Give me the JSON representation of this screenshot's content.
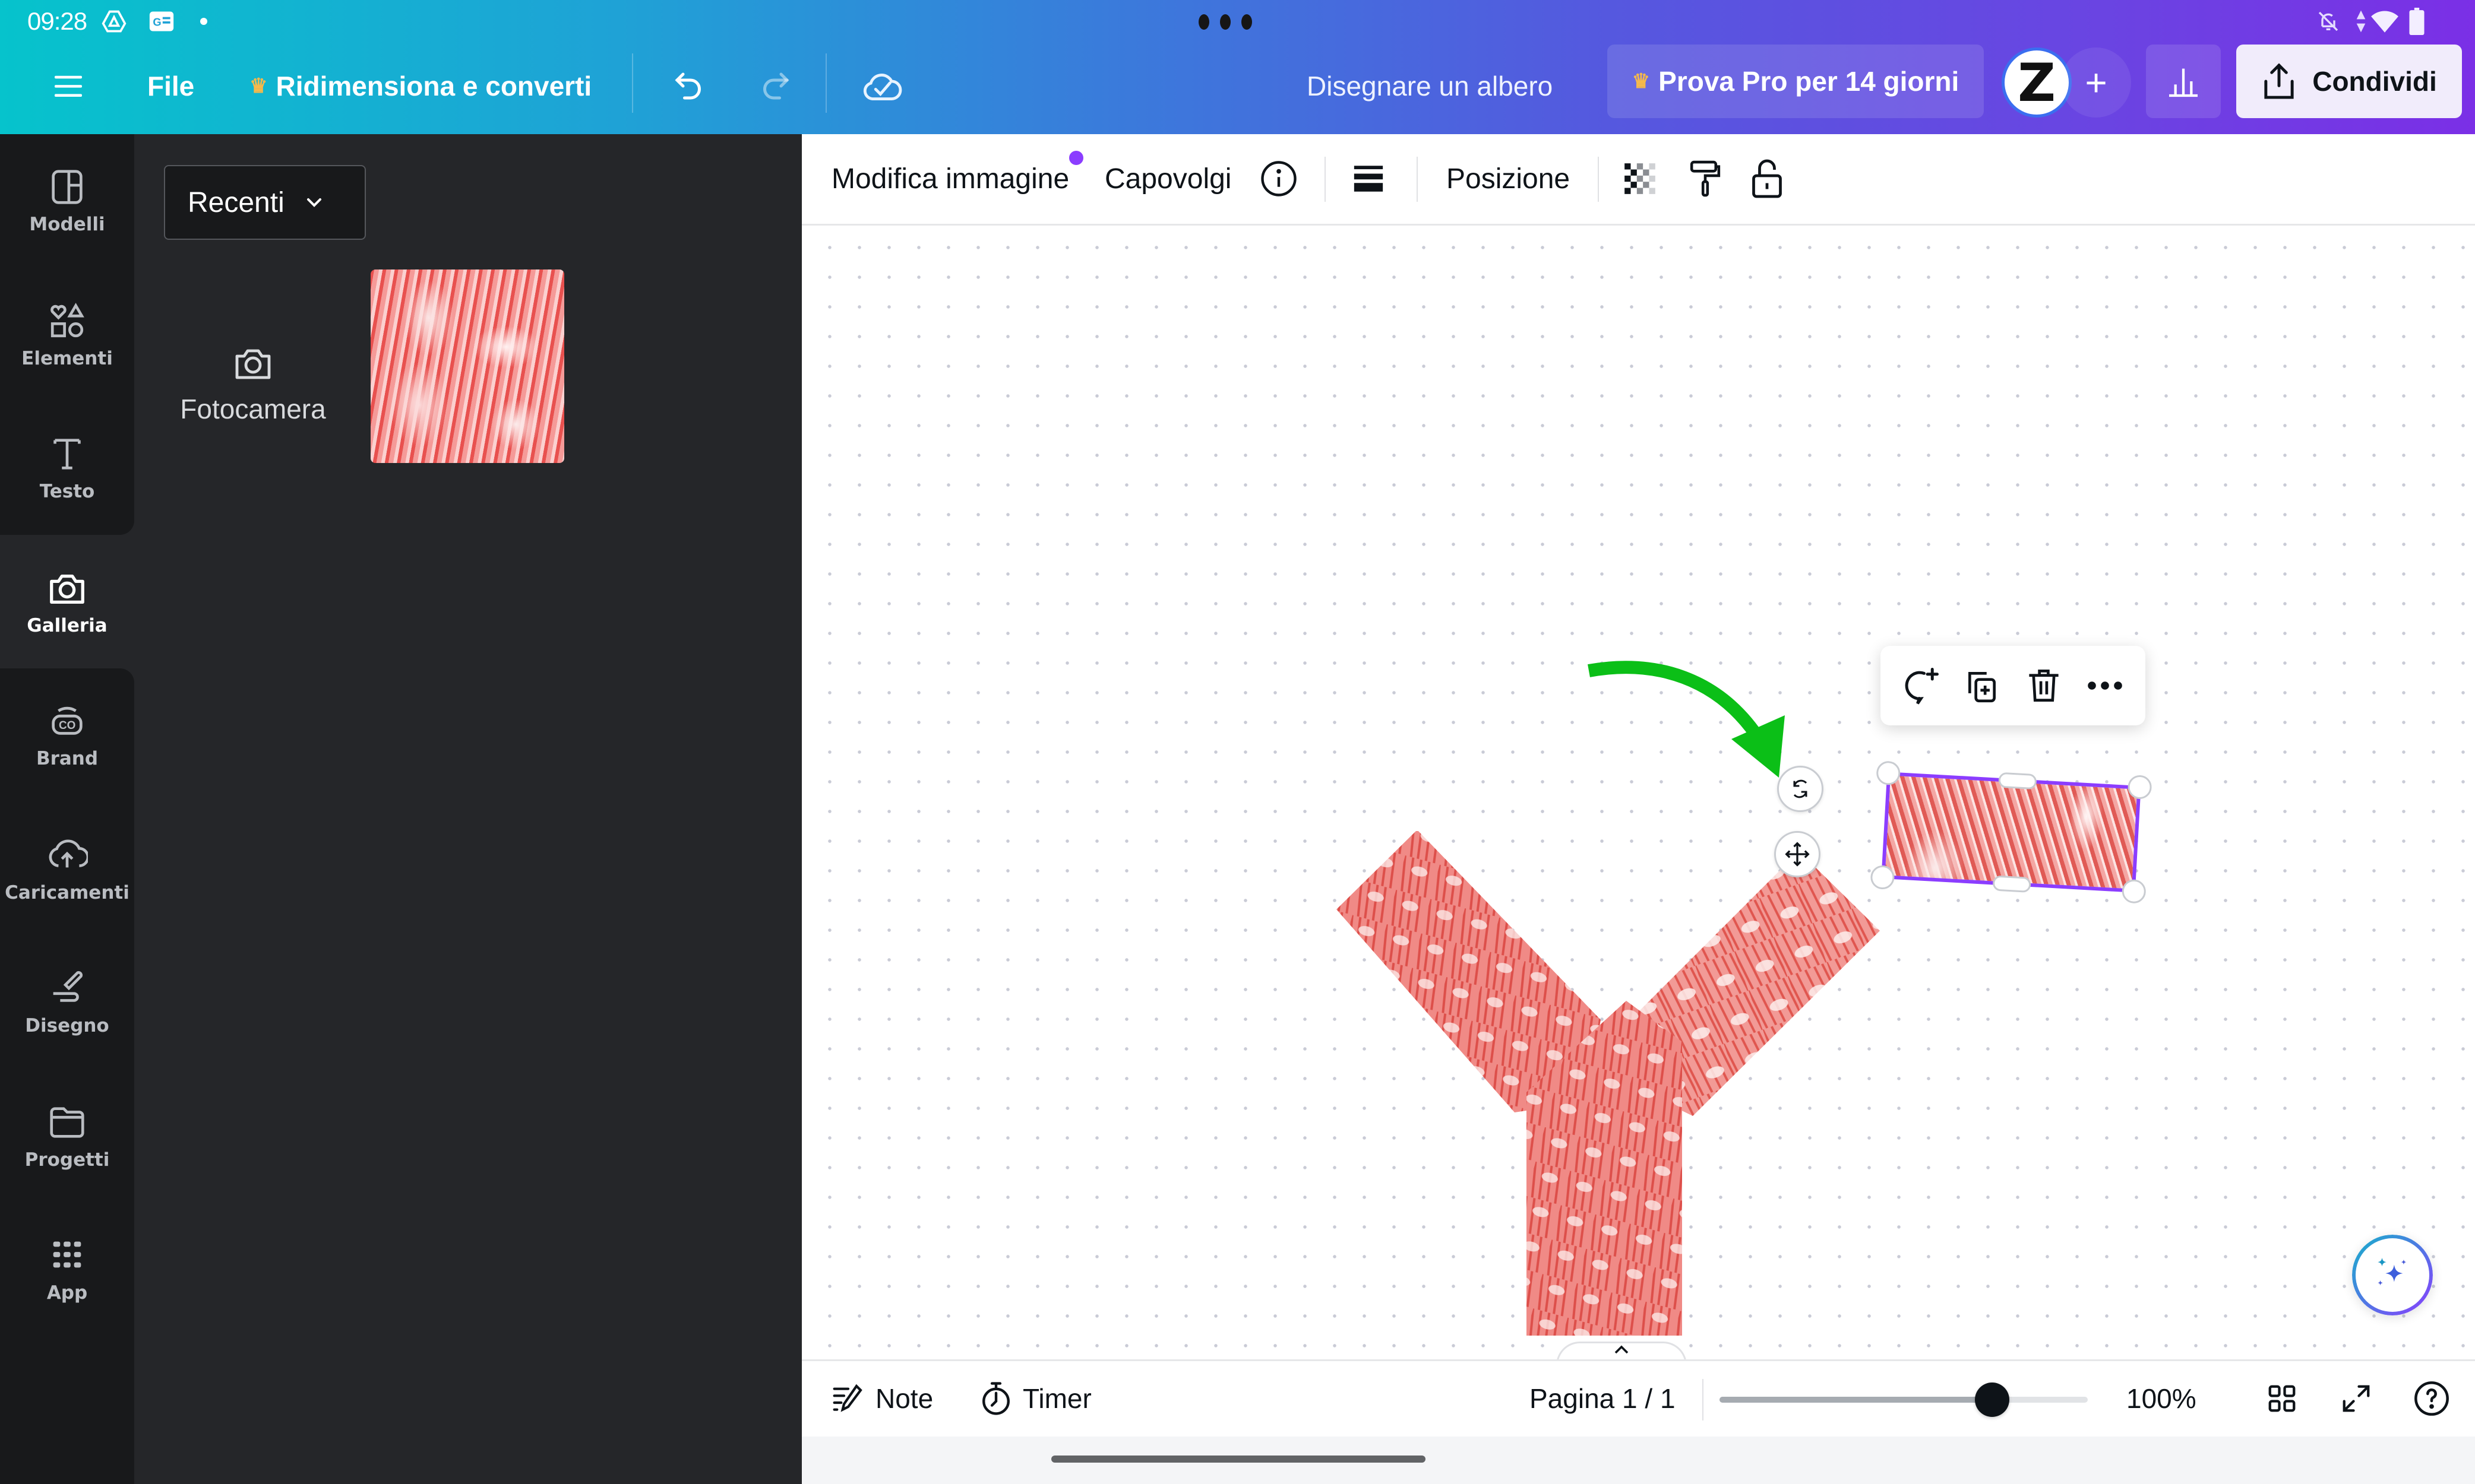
{
  "status_bar": {
    "time": "09:28",
    "left_icons": [
      "drive-icon",
      "gboard-icon",
      "notification-dot"
    ],
    "right_icons": [
      "bell-muted-icon",
      "data-arrows-icon",
      "wifi-icon",
      "battery-icon"
    ]
  },
  "header": {
    "menu_icon": "hamburger-icon",
    "file_label": "File",
    "resize_label": "Ridimensiona e converti",
    "undo_icon": "undo-icon",
    "redo_icon": "redo-icon",
    "save_status_icon": "cloud-check-icon",
    "document_title": "Disegnare un albero",
    "pro_trial_label": "Prova Pro per 14 giorni",
    "avatar_initial": "Z",
    "add_member_label": "+",
    "share_label": "Condividi",
    "colors": {
      "gradient_start": "#06c3cc",
      "gradient_end": "#7b2fe6",
      "crown": "#f6b94b"
    }
  },
  "sidebar": {
    "items": [
      {
        "label": "Modelli",
        "icon": "templates-icon",
        "active": false
      },
      {
        "label": "Elementi",
        "icon": "elements-icon",
        "active": false
      },
      {
        "label": "Testo",
        "icon": "text-icon",
        "active": false
      },
      {
        "label": "Galleria",
        "icon": "camera-icon",
        "active": true
      },
      {
        "label": "Brand",
        "icon": "brand-icon",
        "active": false
      },
      {
        "label": "Caricamenti",
        "icon": "upload-cloud-icon",
        "active": false
      },
      {
        "label": "Disegno",
        "icon": "draw-icon",
        "active": false
      },
      {
        "label": "Progetti",
        "icon": "folder-icon",
        "active": false
      },
      {
        "label": "App",
        "icon": "apps-grid-icon",
        "active": false
      }
    ]
  },
  "panel": {
    "filter_selected": "Recenti",
    "camera_label": "Fotocamera",
    "collapse_icon": "chevron-left-icon"
  },
  "canvas_toolbar": {
    "edit_image_label": "Modifica immagine",
    "flip_label": "Capovolgi",
    "info_icon": "info-icon",
    "border_icon": "border-style-icon",
    "position_label": "Posizione",
    "transparency_icon": "transparency-icon",
    "copy_style_icon": "paint-roller-icon",
    "lock_icon": "unlock-icon",
    "accent": "#8b3dff"
  },
  "floating_toolbar": {
    "buttons": [
      "add-comment-icon",
      "duplicate-icon",
      "trash-icon",
      "more-icon"
    ]
  },
  "canvas": {
    "annotation_arrow_color": "#0bbf17",
    "selection_color": "#8b3dff",
    "rotate_icon": "rotate-icon",
    "move_icon": "move-icon",
    "magic_icon": "sparkles-icon",
    "page_tab_icon": "chevron-up-icon"
  },
  "bottom_bar": {
    "notes_label": "Note",
    "timer_label": "Timer",
    "page_label": "Pagina 1 / 1",
    "zoom_label": "100%",
    "zoom_slider_fraction": 0.74,
    "grid_view_icon": "grid-view-icon",
    "fullscreen_icon": "fullscreen-icon",
    "help_icon": "help-icon"
  }
}
